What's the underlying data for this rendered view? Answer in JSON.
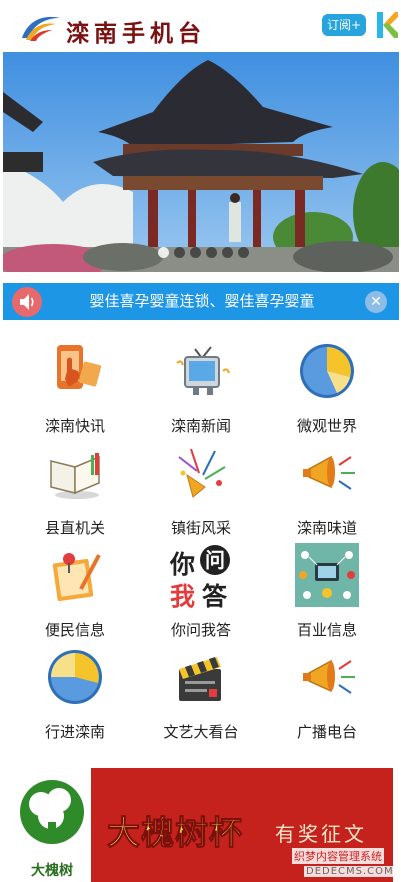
{
  "header": {
    "title": "滦南手机台",
    "subscribe_label": "订阅+",
    "logo_icon": "swoosh-logo-icon",
    "app_badge_icon": "k-app-icon"
  },
  "banner": {
    "slide_count": 6,
    "active_slide": 1
  },
  "notice": {
    "text": "婴佳喜孕婴童连锁、婴佳喜孕婴童",
    "speaker_icon": "speaker-icon",
    "close_glyph": "✕",
    "colors": {
      "bar": "#1e96e6",
      "speaker": "#e8696b"
    }
  },
  "grid": {
    "items": [
      {
        "label": "滦南快讯",
        "icon": "phone-hand-icon"
      },
      {
        "label": "滦南新闻",
        "icon": "television-icon"
      },
      {
        "label": "微观世界",
        "icon": "pie-chart-icon"
      },
      {
        "label": "县直机关",
        "icon": "open-book-icon"
      },
      {
        "label": "镇街风采",
        "icon": "party-popper-icon"
      },
      {
        "label": "滦南味道",
        "icon": "megaphone-icon"
      },
      {
        "label": "便民信息",
        "icon": "notepad-pin-icon"
      },
      {
        "label": "你问我答",
        "icon": "qa-text-icon",
        "icon_text_top": "你",
        "icon_text_circle": "问",
        "icon_text_bottom_left": "我",
        "icon_text_bottom_right": "答"
      },
      {
        "label": "百业信息",
        "icon": "business-network-icon"
      },
      {
        "label": "行进滦南",
        "icon": "pie-chart-icon"
      },
      {
        "label": "文艺大看台",
        "icon": "clapperboard-icon"
      },
      {
        "label": "广播电台",
        "icon": "megaphone-icon"
      }
    ]
  },
  "ad": {
    "brand_label": "大槐树",
    "title": "大槐树杯",
    "subtitle": "有奖征文",
    "watermark_line1": "织梦内容管理系统",
    "watermark_line2": "DEDECMS.COM"
  }
}
